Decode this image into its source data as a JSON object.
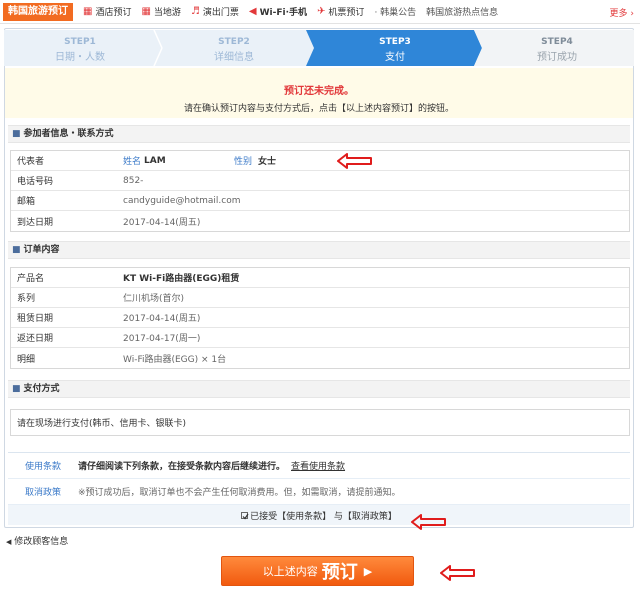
{
  "topnav": {
    "brand": "韩国旅游预订",
    "items": [
      {
        "label": "酒店预订",
        "icon": "hotel-icon"
      },
      {
        "label": "当地游",
        "icon": "tour-icon"
      },
      {
        "label": "演出门票",
        "icon": "ticket-icon"
      },
      {
        "label": "Wi-Fi·手机",
        "icon": "wifi-icon"
      },
      {
        "label": "机票预订",
        "icon": "plane-icon"
      }
    ],
    "extra1": "· 韩巢公告",
    "extra2": "韩国旅游热点信息",
    "more": "更多 ›"
  },
  "steps": [
    {
      "num": "STEP1",
      "label": "日期・人数"
    },
    {
      "num": "STEP2",
      "label": "详细信息"
    },
    {
      "num": "STEP3",
      "label": "支付"
    },
    {
      "num": "STEP4",
      "label": "预订成功"
    }
  ],
  "notice": {
    "title": "预订还未完成。",
    "text": "请在确认预订内容与支付方式后，点击【以上述内容预订】的按钮。"
  },
  "participant": {
    "heading": "参加者信息・联系方式",
    "rep_label": "代表者",
    "name_label": "姓名",
    "name_value": "LAM",
    "gender_label": "性别",
    "gender_value": "女士",
    "phone_label": "电话号码",
    "phone_value": "852-",
    "email_label": "邮箱",
    "email_value": "candyguide@hotmail.com",
    "arrival_label": "到达日期",
    "arrival_value": "2017-04-14(周五)"
  },
  "order": {
    "heading": "订单内容",
    "rows": [
      {
        "label": "产品名",
        "value": "KT Wi-Fi路由器(EGG)租赁"
      },
      {
        "label": "系列",
        "value": "仁川机场(首尔)"
      },
      {
        "label": "租赁日期",
        "value": "2017-04-14(周五)"
      },
      {
        "label": "返还日期",
        "value": "2017-04-17(周一)"
      },
      {
        "label": "明细",
        "value": "Wi-Fi路由器(EGG) × 1台"
      }
    ]
  },
  "payment": {
    "heading": "支付方式",
    "text": "请在现场进行支付(韩币、信用卡、银联卡)"
  },
  "terms": {
    "use_label": "使用条款",
    "use_text": "请仔细阅读下列条款，在接受条款内容后继续进行。",
    "use_link": "查看使用条款",
    "cancel_label": "取消政策",
    "cancel_text": "※预订成功后，取消订单也不会产生任何取消费用。但，如需取消，请提前通知。",
    "accept_text": "已接受【使用条款】 与【取消政策】"
  },
  "back_link": "修改顾客信息",
  "button": {
    "prefix": "以上述内容",
    "main": "预订"
  },
  "colors": {
    "accent": "#f26b21",
    "step_active": "#2f86d8",
    "step_bg": "#eaf1f8",
    "annotation_red": "#e01c1c"
  }
}
